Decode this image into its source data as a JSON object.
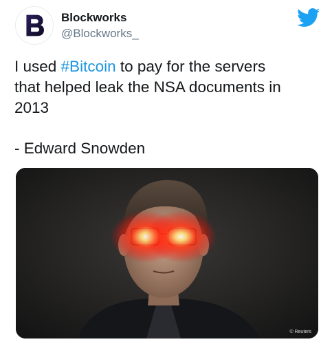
{
  "author": {
    "name": "Blockworks",
    "handle": "@Blockworks_",
    "avatar_icon": "blockworks-logo-icon",
    "avatar_color": "#1f1a3a"
  },
  "platform_icon": "twitter-bird-icon",
  "brand_color": "#1da1f2",
  "tweet": {
    "line1_prefix": "I used ",
    "hashtag": "#Bitcoin",
    "line1_suffix": " to pay for the servers",
    "line2": "that helped leak the NSA documents in",
    "line3": "2013",
    "attribution": "- Edward Snowden"
  },
  "media": {
    "credit": "© Reuters"
  }
}
